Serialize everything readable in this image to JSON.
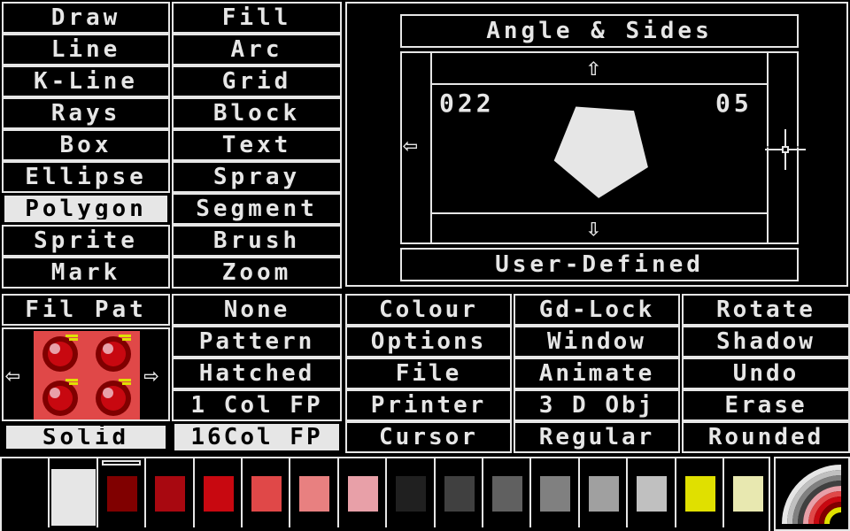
{
  "tools": [
    {
      "label": "Draw",
      "selected": false
    },
    {
      "label": "Fill",
      "selected": false
    },
    {
      "label": "Line",
      "selected": false
    },
    {
      "label": "Arc",
      "selected": false
    },
    {
      "label": "K-Line",
      "selected": false
    },
    {
      "label": "Grid",
      "selected": false
    },
    {
      "label": "Rays",
      "selected": false
    },
    {
      "label": "Block",
      "selected": false
    },
    {
      "label": "Box",
      "selected": false
    },
    {
      "label": "Text",
      "selected": false
    },
    {
      "label": "Ellipse",
      "selected": false
    },
    {
      "label": "Spray",
      "selected": false
    },
    {
      "label": "Polygon",
      "selected": true
    },
    {
      "label": "Segment",
      "selected": false
    },
    {
      "label": "Sprite",
      "selected": false
    },
    {
      "label": "Brush",
      "selected": false
    },
    {
      "label": "Mark",
      "selected": false
    },
    {
      "label": "Zoom",
      "selected": false
    }
  ],
  "polygon_panel": {
    "title": "Angle & Sides",
    "angle": "022",
    "sides": "05",
    "footer": "User-Defined",
    "arrow_up": "⇧",
    "arrow_down": "⇩",
    "arrow_left": "⇦",
    "arrow_right": "⇨",
    "shape_color": "#e6e6e6"
  },
  "fill_pattern": {
    "title": "Fil Pat",
    "arrow_left": "⇦",
    "arrow_right": "⇨",
    "options": [
      {
        "label": "None",
        "selected": false
      },
      {
        "label": "Pattern",
        "selected": false
      },
      {
        "label": "Hatched",
        "selected": false
      },
      {
        "label": "1 Col  FP",
        "selected": false
      },
      {
        "label": "16Col  FP",
        "selected": true
      }
    ],
    "solid": {
      "label": "Solid",
      "selected": true
    }
  },
  "options_grid": [
    "Colour",
    "Gd-Lock",
    "Rotate",
    "Options",
    "Window",
    "Shadow",
    "File",
    "Animate",
    "Undo",
    "Printer",
    "3 D Obj",
    "Erase",
    "Cursor",
    "Regular",
    "Rounded"
  ],
  "palette": [
    {
      "color": "#000000",
      "selected": false
    },
    {
      "color": "#e6e6e6",
      "selected": false
    },
    {
      "color": "#800000",
      "selected": true
    },
    {
      "color": "#a80810",
      "selected": false
    },
    {
      "color": "#c80810",
      "selected": false
    },
    {
      "color": "#e04848",
      "selected": false
    },
    {
      "color": "#e88080",
      "selected": false
    },
    {
      "color": "#e8a0a8",
      "selected": false
    },
    {
      "color": "#202020",
      "selected": false
    },
    {
      "color": "#404040",
      "selected": false
    },
    {
      "color": "#606060",
      "selected": false
    },
    {
      "color": "#808080",
      "selected": false
    },
    {
      "color": "#a0a0a0",
      "selected": false
    },
    {
      "color": "#c0c0c0",
      "selected": false
    },
    {
      "color": "#e0e000",
      "selected": false
    },
    {
      "color": "#e8e8b0",
      "selected": false
    }
  ],
  "rainbow_colors": [
    "#e6e6e6",
    "#c0c0c0",
    "#808080",
    "#404040",
    "#e8a0a8",
    "#e04848",
    "#c80810",
    "#800000",
    "#e0e000"
  ]
}
